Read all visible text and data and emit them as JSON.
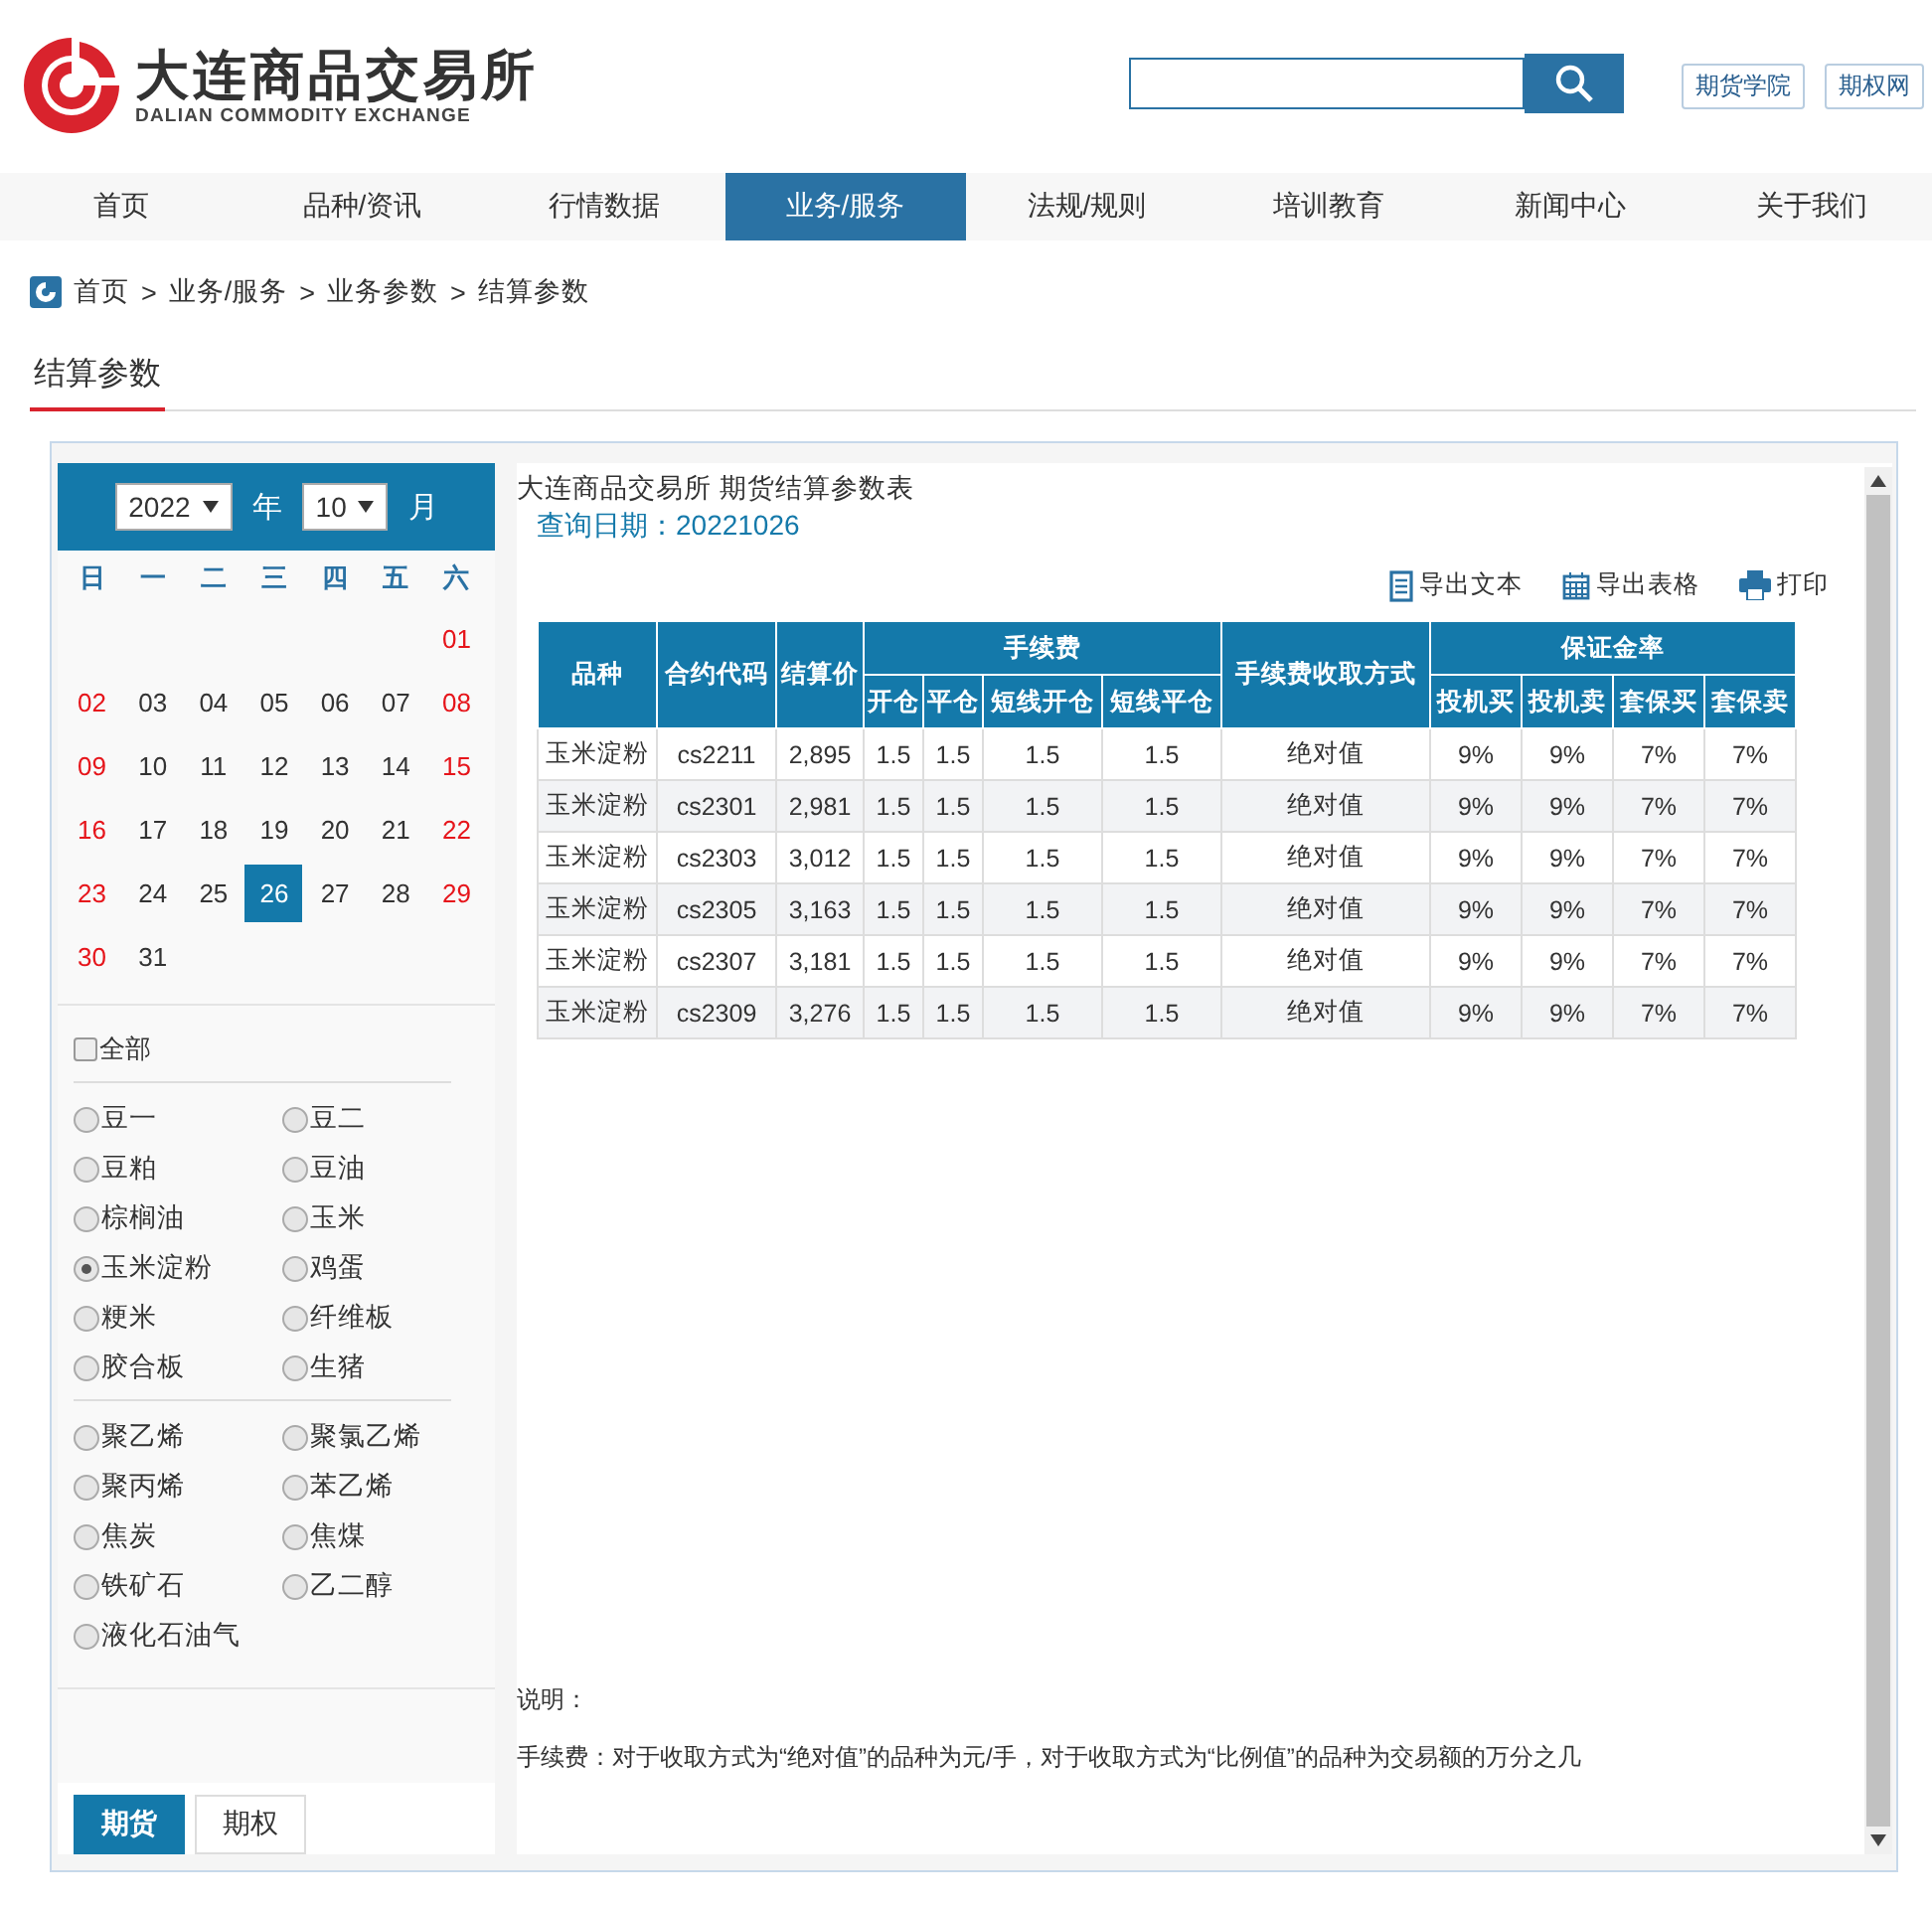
{
  "header": {
    "logo_cn": "大连商品交易所",
    "logo_en": "DALIAN COMMODITY EXCHANGE",
    "links": [
      "期货学院",
      "期权网"
    ]
  },
  "nav": [
    {
      "label": "首页",
      "selected": false
    },
    {
      "label": "品种/资讯",
      "selected": false
    },
    {
      "label": "行情数据",
      "selected": false
    },
    {
      "label": "业务/服务",
      "selected": true
    },
    {
      "label": "法规/规则",
      "selected": false
    },
    {
      "label": "培训教育",
      "selected": false
    },
    {
      "label": "新闻中心",
      "selected": false
    },
    {
      "label": "关于我们",
      "selected": false
    }
  ],
  "breadcrumb": {
    "separator": ">",
    "items": [
      "首页",
      "业务/服务",
      "业务参数",
      "结算参数"
    ]
  },
  "page_title": "结算参数",
  "calendar": {
    "year": "2022",
    "year_label": "年",
    "month": "10",
    "month_label": "月",
    "weekdays": [
      "日",
      "一",
      "二",
      "三",
      "四",
      "五",
      "六"
    ],
    "weeks": [
      [
        {
          "day": "01",
          "weekend": true,
          "selected": false
        }
      ],
      [
        {
          "day": "02",
          "weekend": true,
          "selected": false
        },
        {
          "day": "03",
          "weekend": false,
          "selected": false
        },
        {
          "day": "04",
          "weekend": false,
          "selected": false
        },
        {
          "day": "05",
          "weekend": false,
          "selected": false
        },
        {
          "day": "06",
          "weekend": false,
          "selected": false
        },
        {
          "day": "07",
          "weekend": false,
          "selected": false
        },
        {
          "day": "08",
          "weekend": true,
          "selected": false
        }
      ],
      [
        {
          "day": "09",
          "weekend": true,
          "selected": false
        },
        {
          "day": "10",
          "weekend": false,
          "selected": false
        },
        {
          "day": "11",
          "weekend": false,
          "selected": false
        },
        {
          "day": "12",
          "weekend": false,
          "selected": false
        },
        {
          "day": "13",
          "weekend": false,
          "selected": false
        },
        {
          "day": "14",
          "weekend": false,
          "selected": false
        },
        {
          "day": "15",
          "weekend": true,
          "selected": false
        }
      ],
      [
        {
          "day": "16",
          "weekend": true,
          "selected": false
        },
        {
          "day": "17",
          "weekend": false,
          "selected": false
        },
        {
          "day": "18",
          "weekend": false,
          "selected": false
        },
        {
          "day": "19",
          "weekend": false,
          "selected": false
        },
        {
          "day": "20",
          "weekend": false,
          "selected": false
        },
        {
          "day": "21",
          "weekend": false,
          "selected": false
        },
        {
          "day": "22",
          "weekend": true,
          "selected": false
        }
      ],
      [
        {
          "day": "23",
          "weekend": true,
          "selected": false
        },
        {
          "day": "24",
          "weekend": false,
          "selected": false
        },
        {
          "day": "25",
          "weekend": false,
          "selected": false
        },
        {
          "day": "26",
          "weekend": false,
          "selected": true
        },
        {
          "day": "27",
          "weekend": false,
          "selected": false
        },
        {
          "day": "28",
          "weekend": false,
          "selected": false
        },
        {
          "day": "29",
          "weekend": true,
          "selected": false
        }
      ],
      [
        {
          "day": "30",
          "weekend": true,
          "selected": false
        },
        {
          "day": "31",
          "weekend": false,
          "selected": false
        }
      ]
    ]
  },
  "all_checkbox": {
    "label": "全部",
    "checked": false
  },
  "product_groups": [
    [
      {
        "label": "豆一",
        "selected": false
      },
      {
        "label": "豆二",
        "selected": false
      },
      {
        "label": "豆粕",
        "selected": false
      },
      {
        "label": "豆油",
        "selected": false
      },
      {
        "label": "棕榈油",
        "selected": false
      },
      {
        "label": "玉米",
        "selected": false
      },
      {
        "label": "玉米淀粉",
        "selected": true
      },
      {
        "label": "鸡蛋",
        "selected": false
      },
      {
        "label": "粳米",
        "selected": false
      },
      {
        "label": "纤维板",
        "selected": false
      },
      {
        "label": "胶合板",
        "selected": false
      },
      {
        "label": "生猪",
        "selected": false
      }
    ],
    [
      {
        "label": "聚乙烯",
        "selected": false
      },
      {
        "label": "聚氯乙烯",
        "selected": false
      },
      {
        "label": "聚丙烯",
        "selected": false
      },
      {
        "label": "苯乙烯",
        "selected": false
      },
      {
        "label": "焦炭",
        "selected": false
      },
      {
        "label": "焦煤",
        "selected": false
      },
      {
        "label": "铁矿石",
        "selected": false
      },
      {
        "label": "乙二醇",
        "selected": false
      },
      {
        "label": "液化石油气",
        "selected": false
      }
    ]
  ],
  "market_tabs": [
    {
      "label": "期货",
      "selected": true
    },
    {
      "label": "期权",
      "selected": false
    }
  ],
  "report": {
    "title": "大连商品交易所 期货结算参数表",
    "query_date": "查询日期：20221026",
    "tools": [
      {
        "kind": "text",
        "label": "导出文本"
      },
      {
        "kind": "sheet",
        "label": "导出表格"
      },
      {
        "kind": "print",
        "label": "打印"
      }
    ],
    "header_top": [
      {
        "label": "品种",
        "kind": "single"
      },
      {
        "label": "合约代码",
        "kind": "single"
      },
      {
        "label": "结算价",
        "kind": "single"
      },
      {
        "label": "手续费",
        "kind": "group"
      },
      {
        "label": "手续费收取方式",
        "kind": "single"
      },
      {
        "label": "保证金率",
        "kind": "group"
      }
    ],
    "header_sub": [
      "开仓",
      "平仓",
      "短线开仓",
      "短线平仓",
      "投机买",
      "投机卖",
      "套保买",
      "套保卖"
    ],
    "rows": [
      [
        "玉米淀粉",
        "cs2211",
        "2,895",
        "1.5",
        "1.5",
        "1.5",
        "1.5",
        "绝对值",
        "9%",
        "9%",
        "7%",
        "7%"
      ],
      [
        "玉米淀粉",
        "cs2301",
        "2,981",
        "1.5",
        "1.5",
        "1.5",
        "1.5",
        "绝对值",
        "9%",
        "9%",
        "7%",
        "7%"
      ],
      [
        "玉米淀粉",
        "cs2303",
        "3,012",
        "1.5",
        "1.5",
        "1.5",
        "1.5",
        "绝对值",
        "9%",
        "9%",
        "7%",
        "7%"
      ],
      [
        "玉米淀粉",
        "cs2305",
        "3,163",
        "1.5",
        "1.5",
        "1.5",
        "1.5",
        "绝对值",
        "9%",
        "9%",
        "7%",
        "7%"
      ],
      [
        "玉米淀粉",
        "cs2307",
        "3,181",
        "1.5",
        "1.5",
        "1.5",
        "1.5",
        "绝对值",
        "9%",
        "9%",
        "7%",
        "7%"
      ],
      [
        "玉米淀粉",
        "cs2309",
        "3,276",
        "1.5",
        "1.5",
        "1.5",
        "1.5",
        "绝对值",
        "9%",
        "9%",
        "7%",
        "7%"
      ]
    ],
    "notes": [
      "说明：",
      "手续费：对于收取方式为“绝对值”的品种为元/手，对于收取方式为“比例值”的品种为交易额的万分之几"
    ]
  }
}
